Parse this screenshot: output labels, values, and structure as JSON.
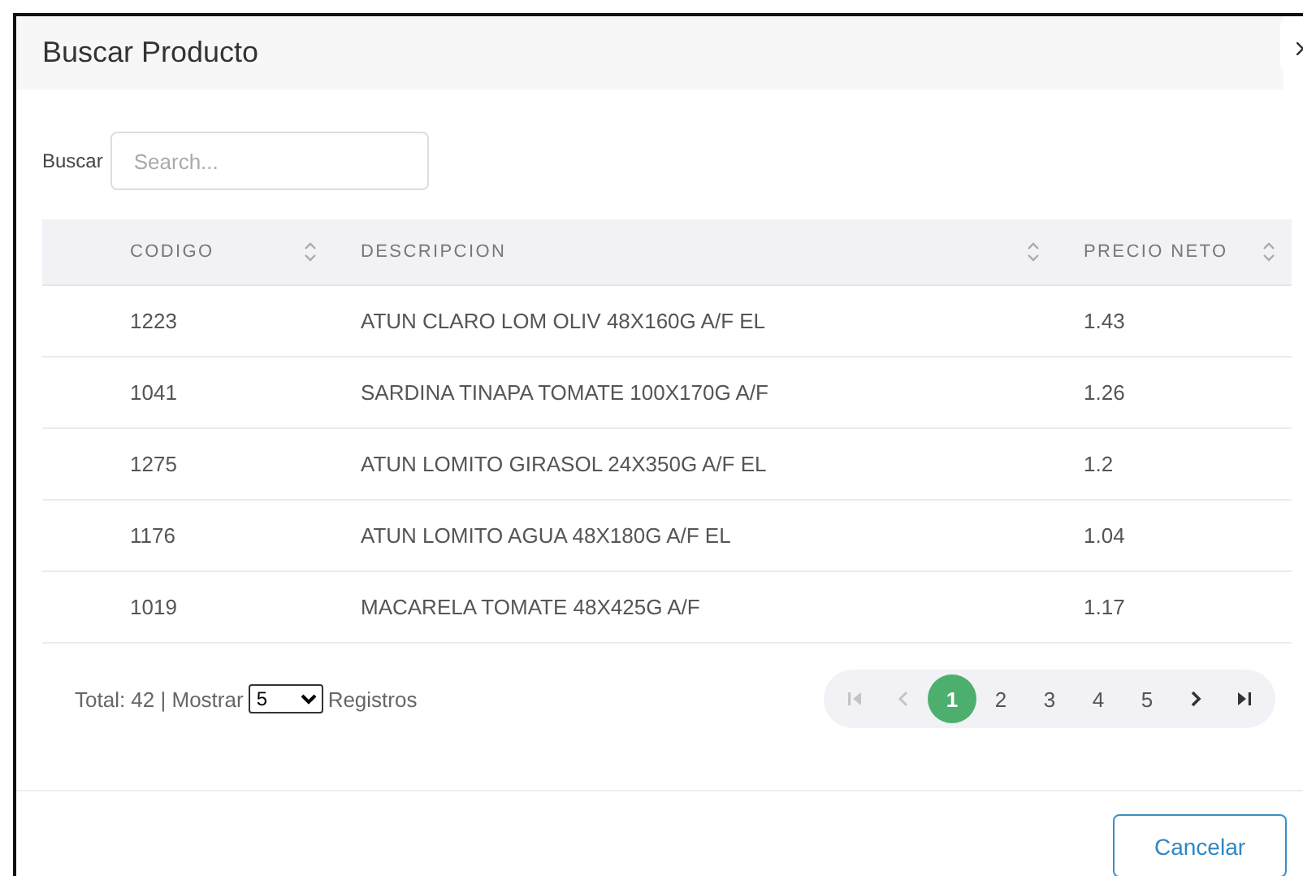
{
  "dialog": {
    "title": "Buscar Producto"
  },
  "search": {
    "label": "Buscar",
    "placeholder": "Search..."
  },
  "table": {
    "columns": [
      "CODIGO",
      "DESCRIPCION",
      "PRECIO NETO"
    ],
    "rows": [
      [
        "1223",
        "ATUN CLARO LOM OLIV 48X160G A/F EL",
        "1.43"
      ],
      [
        "1041",
        "SARDINA TINAPA TOMATE 100X170G A/F",
        "1.26"
      ],
      [
        "1275",
        "ATUN LOMITO GIRASOL 24X350G A/F EL",
        "1.2"
      ],
      [
        "1176",
        "ATUN LOMITO AGUA 48X180G A/F EL",
        "1.04"
      ],
      [
        "1019",
        "MACARELA TOMATE 48X425G A/F",
        "1.17"
      ]
    ]
  },
  "footer": {
    "total": "Total: 42 | Mostrar",
    "page_size": "5",
    "suffix": "Registros"
  },
  "pagination": {
    "first_disabled": true,
    "prev_disabled": true,
    "next_disabled": false,
    "last_disabled": false,
    "pages": [
      {
        "label": "1",
        "selected": true
      },
      {
        "label": "2",
        "selected": false
      },
      {
        "label": "3",
        "selected": false
      },
      {
        "label": "4",
        "selected": false
      },
      {
        "label": "5",
        "selected": false
      }
    ]
  },
  "buttons": [
    "Cancelar"
  ]
}
